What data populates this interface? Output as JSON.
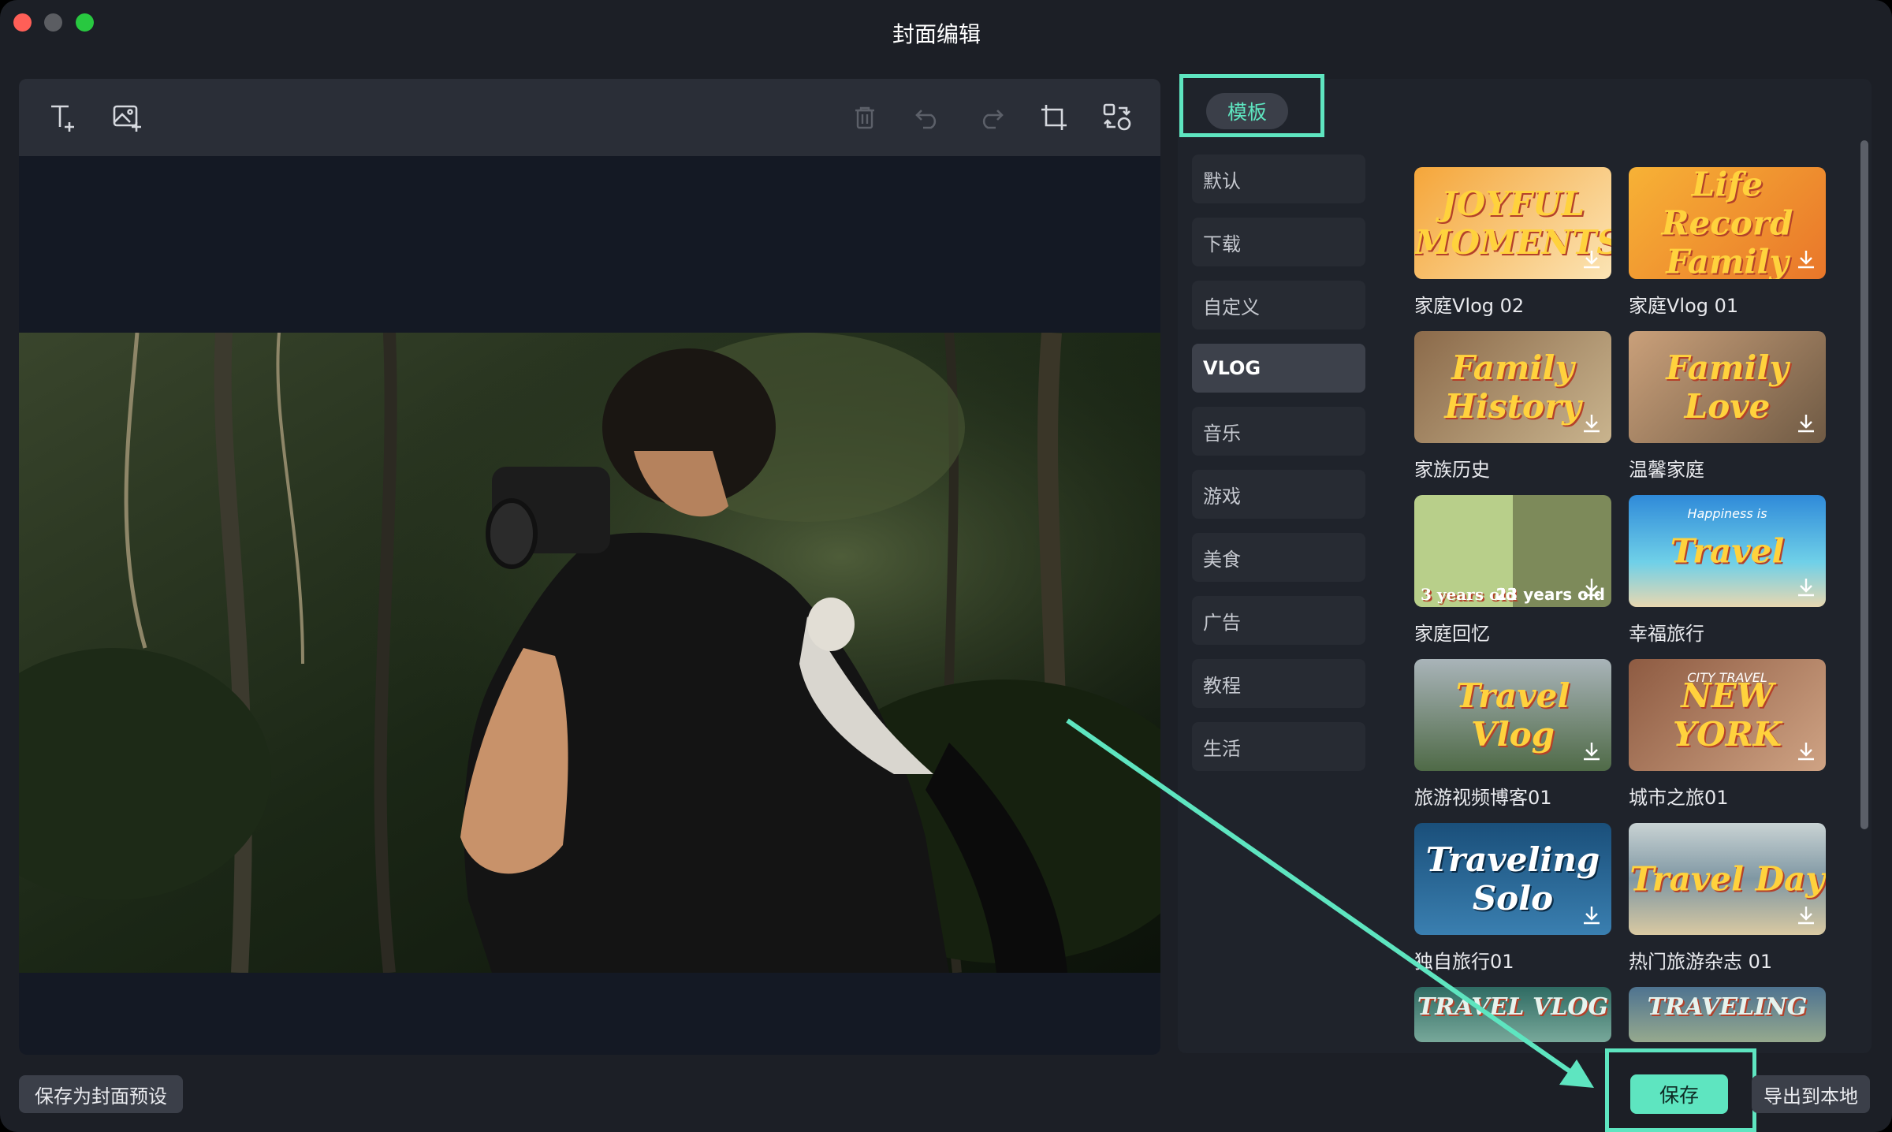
{
  "window": {
    "title": "封面编辑"
  },
  "toolbar": {
    "tools": [
      "text-add-icon",
      "image-add-icon",
      "trash-icon",
      "undo-icon",
      "redo-icon",
      "crop-icon",
      "replace-icon"
    ]
  },
  "panel": {
    "tab_label": "模板",
    "categories": [
      "默认",
      "下载",
      "自定义",
      "VLOG",
      "音乐",
      "游戏",
      "美食",
      "广告",
      "教程",
      "生活"
    ],
    "active_category": "VLOG",
    "templates": [
      {
        "label": "家庭Vlog 02",
        "thumb_text": "JOYFUL MOMENTS"
      },
      {
        "label": "家庭Vlog 01",
        "thumb_text": "Life Record Family"
      },
      {
        "label": "家族历史",
        "thumb_text": "Family History"
      },
      {
        "label": "温馨家庭",
        "thumb_text": "Family Love"
      },
      {
        "label": "家庭回忆",
        "thumb_text": "3 years old",
        "thumb_text_2": "23 years old"
      },
      {
        "label": "幸福旅行",
        "thumb_text": "Travel",
        "thumb_sub": "Happiness is"
      },
      {
        "label": "旅游视频博客01",
        "thumb_text": "Travel Vlog"
      },
      {
        "label": "城市之旅01",
        "thumb_text": "NEW YORK",
        "thumb_sub": "CITY TRAVEL"
      },
      {
        "label": "独自旅行01",
        "thumb_text": "Traveling Solo"
      },
      {
        "label": "热门旅游杂志 01",
        "thumb_text": "Travel Day"
      },
      {
        "label": "",
        "thumb_text": "TRAVEL VLOG"
      },
      {
        "label": "",
        "thumb_text": "TRAVELING"
      }
    ]
  },
  "footer": {
    "save_preset_label": "保存为封面预设",
    "save_label": "保存",
    "export_label": "导出到本地"
  },
  "colors": {
    "accent": "#5ee5c0",
    "window_bg": "#1c1f26",
    "panel_bg": "#1f232b"
  }
}
